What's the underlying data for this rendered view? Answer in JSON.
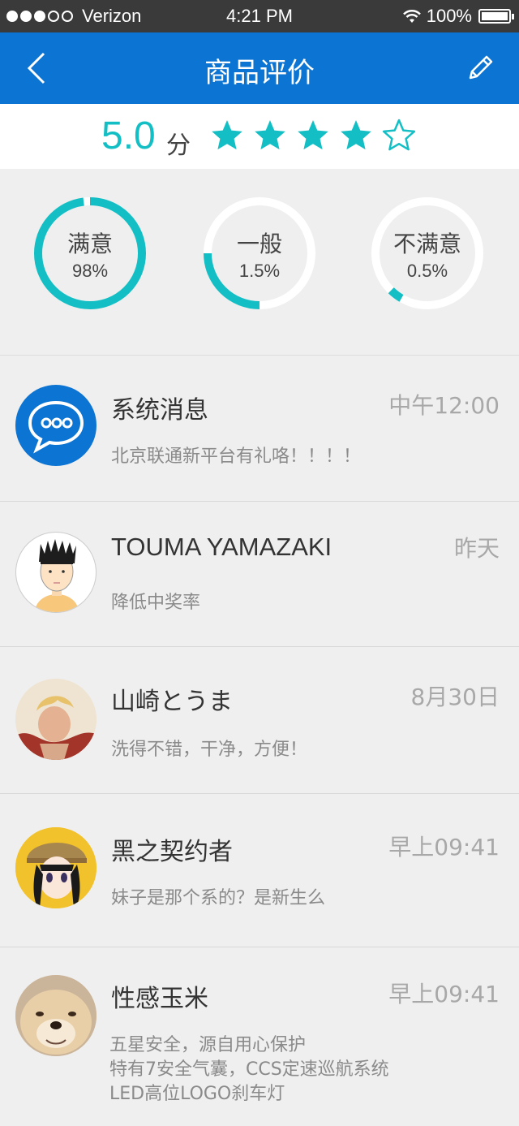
{
  "status": {
    "carrier": "Verizon",
    "time": "4:21 PM",
    "battery": "100%",
    "signal_bars": 3,
    "signal_total": 5
  },
  "nav": {
    "title": "商品评价",
    "back_icon": "chevron-left-icon",
    "edit_icon": "pencil-icon"
  },
  "rating": {
    "score": "5.0",
    "unit": "分",
    "filled_stars": 4,
    "total_stars": 5,
    "accent_color": "#13bfc4"
  },
  "stats": [
    {
      "label": "满意",
      "percent": "98%",
      "fraction": 0.98
    },
    {
      "label": "一般",
      "percent": "1.5%",
      "fraction": 0.25
    },
    {
      "label": "不满意",
      "percent": "0.5%",
      "fraction": 0.04
    }
  ],
  "messages": [
    {
      "name": "系统消息",
      "time": "中午12:00",
      "text": "北京联通新平台有礼咯！！！！"
    },
    {
      "name": "TOUMA YAMAZAKI",
      "time": "昨天",
      "text": "降低中奖率"
    },
    {
      "name": "山崎とうま",
      "time": "8月30日",
      "text": "洗得不错，干净，方便！"
    },
    {
      "name": "黑之契约者",
      "time": "早上09:41",
      "text": "妹子是那个系的？是新生么"
    },
    {
      "name": "性感玉米",
      "time": "早上09:41",
      "text": "五星安全，源自用心保护",
      "text2": "特有7安全气囊，CCS定速巡航系统",
      "text3": "LED高位LOGO刹车灯"
    }
  ],
  "colors": {
    "nav": "#0c74d2",
    "accent": "#13bfc4",
    "background": "#efefef"
  }
}
